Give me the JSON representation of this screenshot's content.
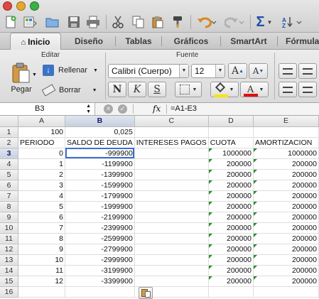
{
  "toolbar": {
    "buttons": [
      "new-icon",
      "templates-icon",
      "open-icon",
      "save-icon",
      "print-icon",
      "cut-icon",
      "copy-icon",
      "paste-icon",
      "format-painter-icon",
      "undo-icon",
      "redo-icon",
      "autosum-icon",
      "sort-icon"
    ]
  },
  "ribbon_tabs": [
    {
      "label": "Inicio",
      "active": true
    },
    {
      "label": "Diseño"
    },
    {
      "label": "Tablas"
    },
    {
      "label": "Gráficos"
    },
    {
      "label": "SmartArt"
    },
    {
      "label": "Fórmula"
    }
  ],
  "ribbon": {
    "editar_title": "Editar",
    "fuente_title": "Fuente",
    "paste_label": "Pegar",
    "fill_label": "Rellenar",
    "clear_label": "Borrar",
    "font_name": "Calibri (Cuerpo)",
    "font_size": "12",
    "bold": "N",
    "italic": "K",
    "underline": "S",
    "grow_font": "A",
    "shrink_font": "A",
    "font_color": "A",
    "highlight_color": "#f5e600",
    "font_color_value": "#e01010"
  },
  "formula_bar": {
    "name_box": "B3",
    "fx_label": "fx",
    "formula": "=A1-E3"
  },
  "grid": {
    "columns": [
      "A",
      "B",
      "C",
      "D",
      "E"
    ],
    "selected_column": "B",
    "selected_row": "3",
    "rows": [
      {
        "n": "1",
        "cells": [
          "100",
          "0,025",
          "",
          "",
          ""
        ]
      },
      {
        "n": "2",
        "cells": [
          "PERIODO",
          "SALDO DE DEUDA",
          "INTERESES PAGOS",
          "CUOTA",
          "AMORTIZACION"
        ]
      },
      {
        "n": "3",
        "cells": [
          "0",
          "-999900",
          "",
          "1000000",
          "1000000"
        ]
      },
      {
        "n": "4",
        "cells": [
          "1",
          "-1199900",
          "",
          "200000",
          "200000"
        ]
      },
      {
        "n": "5",
        "cells": [
          "2",
          "-1399900",
          "",
          "200000",
          "200000"
        ]
      },
      {
        "n": "6",
        "cells": [
          "3",
          "-1599900",
          "",
          "200000",
          "200000"
        ]
      },
      {
        "n": "7",
        "cells": [
          "4",
          "-1799900",
          "",
          "200000",
          "200000"
        ]
      },
      {
        "n": "8",
        "cells": [
          "5",
          "-1999900",
          "",
          "200000",
          "200000"
        ]
      },
      {
        "n": "9",
        "cells": [
          "6",
          "-2199900",
          "",
          "200000",
          "200000"
        ]
      },
      {
        "n": "10",
        "cells": [
          "7",
          "-2399900",
          "",
          "200000",
          "200000"
        ]
      },
      {
        "n": "11",
        "cells": [
          "8",
          "-2599900",
          "",
          "200000",
          "200000"
        ]
      },
      {
        "n": "12",
        "cells": [
          "9",
          "-2799900",
          "",
          "200000",
          "200000"
        ]
      },
      {
        "n": "13",
        "cells": [
          "10",
          "-2999900",
          "",
          "200000",
          "200000"
        ]
      },
      {
        "n": "14",
        "cells": [
          "11",
          "-3199900",
          "",
          "200000",
          "200000"
        ]
      },
      {
        "n": "15",
        "cells": [
          "12",
          "-3399900",
          "",
          "200000",
          "200000"
        ]
      },
      {
        "n": "16",
        "cells": [
          "",
          "",
          "",
          "",
          ""
        ]
      }
    ]
  }
}
